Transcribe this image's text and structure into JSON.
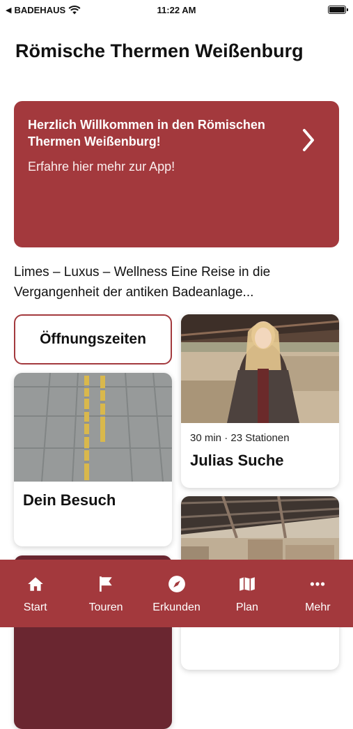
{
  "status": {
    "carrier": "BADEHAUS",
    "time": "11:22 AM"
  },
  "page_title": "Römische Thermen Weißenburg",
  "welcome": {
    "title": "Herzlich Willkommen in den Römischen Thermen Weißenburg!",
    "subtitle": "Erfahre hier mehr zur App!"
  },
  "intro": "Limes – Luxus – Wellness Eine Reise in die Vergangenheit der antiken Badeanlage...",
  "cards": {
    "hours_label": "Öffnungszeiten",
    "julia": {
      "meta": "30 min · 23 Stationen",
      "title": "Julias Suche"
    },
    "visit": {
      "title": "Dein Besuch"
    }
  },
  "tabs": [
    {
      "label": "Start",
      "icon": "home-icon"
    },
    {
      "label": "Touren",
      "icon": "flag-icon"
    },
    {
      "label": "Erkunden",
      "icon": "compass-icon"
    },
    {
      "label": "Plan",
      "icon": "map-icon"
    },
    {
      "label": "Mehr",
      "icon": "more-icon"
    }
  ],
  "colors": {
    "accent": "#a3393d"
  }
}
